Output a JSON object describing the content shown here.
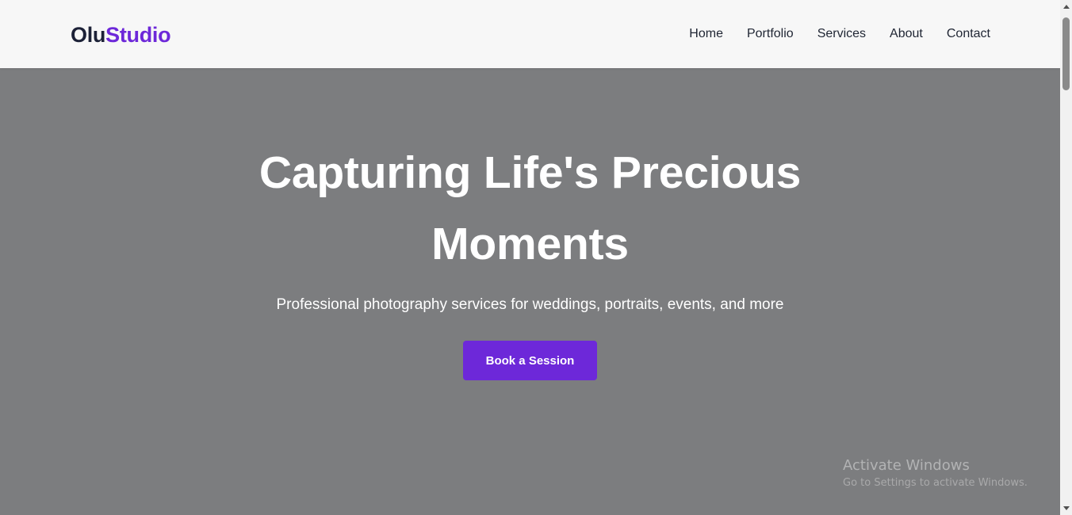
{
  "brand": {
    "logo_part1": "Olu",
    "logo_part2": "Studio",
    "primary_color": "#6d28d9",
    "dark_color": "#1c2137"
  },
  "nav": {
    "items": [
      {
        "label": "Home"
      },
      {
        "label": "Portfolio"
      },
      {
        "label": "Services"
      },
      {
        "label": "About"
      },
      {
        "label": "Contact"
      }
    ]
  },
  "hero": {
    "title_line1": "Capturing Life's Precious",
    "title_line2": "Moments",
    "subtitle": "Professional photography services for weddings, portraits, events, and more",
    "cta_label": "Book a Session",
    "background_color": "#7c7d7f"
  },
  "watermark": {
    "title": "Activate Windows",
    "subtitle": "Go to Settings to activate Windows."
  },
  "scrollbar": {
    "up_icon": "chevron-up-icon",
    "down_icon": "chevron-down-icon"
  }
}
